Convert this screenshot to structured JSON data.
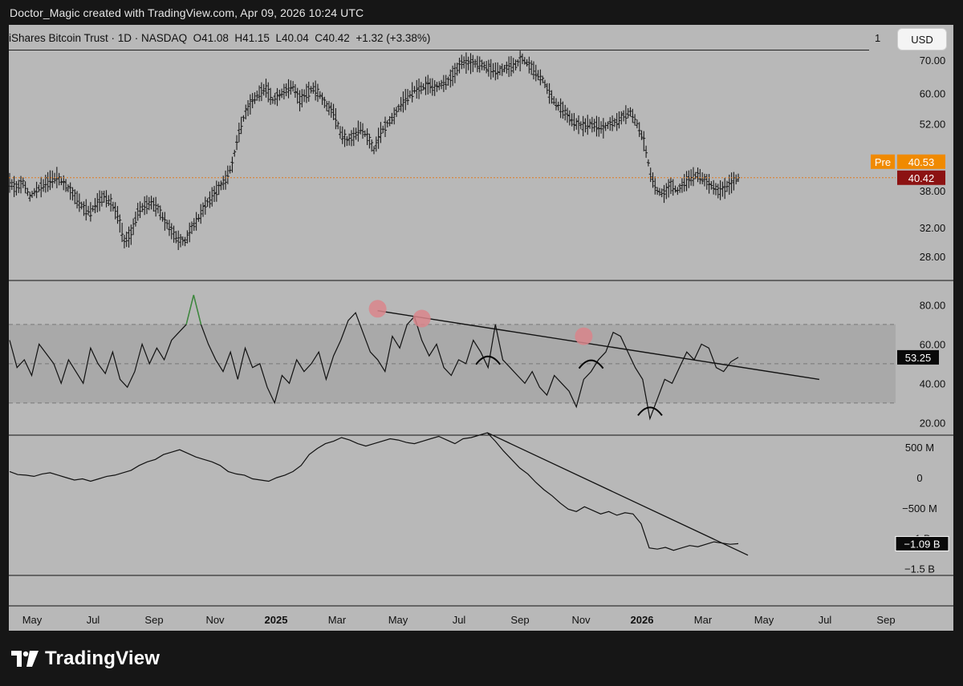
{
  "caption": "Doctor_Magic created with TradingView.com, Apr 09, 2026 10:24 UTC",
  "symbol": {
    "title": "iShares Bitcoin Trust · 1D · NASDAQ",
    "open": "O41.08",
    "high": "H41.15",
    "low": "L40.04",
    "close": "C40.42",
    "change": "+1.32 (+3.38%)"
  },
  "scale_mode": "1",
  "currency": "USD",
  "brand": "TradingView",
  "colors": {
    "background": "#b8b8b8",
    "price_line": "#e07b20",
    "pre_label": "#f08a00",
    "last_label": "#8c1212",
    "rsi_band": "#a9a9a9",
    "dark_label": "#0a0a0a",
    "pivot_marker": "#d9858b"
  },
  "chart_data": [
    {
      "type": "candlestick",
      "series": [
        {
          "name": "iShares Bitcoin Trust",
          "values": [
            39.5,
            38.5,
            39.5,
            37.0,
            38.2,
            39.0,
            40.0,
            40.5,
            39.5,
            38.0,
            36.5,
            35.0,
            34.5,
            36.0,
            37.0,
            36.0,
            34.0,
            30.0,
            31.0,
            34.5,
            35.5,
            36.0,
            35.0,
            33.0,
            31.5,
            30.2,
            30.0,
            32.0,
            33.5,
            35.5,
            37.0,
            38.5,
            40.0,
            43.0,
            50.0,
            55.0,
            58.0,
            60.0,
            61.5,
            58.0,
            59.5,
            61.0,
            62.0,
            58.0,
            60.0,
            61.5,
            59.5,
            56.5,
            55.0,
            50.0,
            48.0,
            49.0,
            51.0,
            49.0,
            46.0,
            50.0,
            52.0,
            54.0,
            57.0,
            59.0,
            61.0,
            61.5,
            62.5,
            61.5,
            62.5,
            63.5,
            66.0,
            69.5,
            69.0,
            69.0,
            68.5,
            67.5,
            66.5,
            67.0,
            68.0,
            68.5,
            70.5,
            68.5,
            66.0,
            64.0,
            60.0,
            57.0,
            55.5,
            53.5,
            52.0,
            51.5,
            52.0,
            51.5,
            51.0,
            52.0,
            52.5,
            54.0,
            55.0,
            52.0,
            48.0,
            41.0,
            38.0,
            37.5,
            39.0,
            38.0,
            39.5,
            40.5,
            41.0,
            40.0,
            39.0,
            38.0,
            38.5,
            39.5,
            40.42
          ]
        }
      ],
      "ylim": [
        25.0,
        73.0
      ],
      "y_scale": "log",
      "y_ticks": [
        "70.00",
        "60.00",
        "52.00",
        "38.00",
        "32.00",
        "28.00"
      ],
      "y_tick_values": [
        70,
        60,
        52,
        38,
        32,
        28
      ],
      "last_close": {
        "label": "40.42",
        "value": 40.42
      },
      "premarket": {
        "tag": "Pre",
        "label": "40.53",
        "value": 40.53
      }
    },
    {
      "type": "line",
      "series": [
        {
          "name": "RSI",
          "values": [
            62,
            48,
            52,
            44,
            60,
            55,
            50,
            40,
            52,
            46,
            40,
            58,
            50,
            45,
            56,
            42,
            38,
            46,
            60,
            50,
            58,
            52,
            62,
            66,
            70,
            85,
            70,
            60,
            52,
            46,
            56,
            42,
            58,
            48,
            50,
            38,
            30,
            44,
            40,
            52,
            46,
            50,
            56,
            42,
            54,
            62,
            72,
            76,
            66,
            56,
            52,
            46,
            64,
            58,
            70,
            74,
            62,
            54,
            60,
            48,
            44,
            52,
            50,
            62,
            56,
            48,
            70,
            52,
            48,
            44,
            40,
            46,
            38,
            34,
            44,
            40,
            36,
            28,
            42,
            46,
            52,
            56,
            66,
            64,
            56,
            48,
            42,
            22,
            32,
            42,
            40,
            48,
            56,
            52,
            60,
            58,
            48,
            46,
            51,
            53.25
          ]
        }
      ],
      "ylim": [
        14,
        92
      ],
      "y_ticks": [
        "80.00",
        "60.00",
        "40.00",
        "20.00"
      ],
      "y_tick_values": [
        80,
        60,
        40,
        20
      ],
      "band": [
        30,
        70
      ],
      "midline": 50,
      "last": {
        "label": "53.25",
        "value": 53.25
      },
      "trendline_points": [
        [
          50,
          77
        ],
        [
          110,
          42
        ]
      ],
      "pivot_marker_points": [
        [
          50,
          78
        ],
        [
          56,
          73
        ],
        [
          78,
          64
        ]
      ],
      "annotation_arcs_near": [
        65,
        79,
        87
      ]
    },
    {
      "type": "line",
      "series": [
        {
          "name": "Volume flow",
          "values": [
            100,
            50,
            40,
            20,
            60,
            80,
            40,
            0,
            -40,
            -20,
            -60,
            -20,
            20,
            40,
            80,
            120,
            200,
            260,
            300,
            380,
            420,
            460,
            400,
            340,
            300,
            260,
            200,
            100,
            60,
            40,
            -20,
            -40,
            -60,
            0,
            40,
            100,
            200,
            380,
            480,
            560,
            600,
            660,
            620,
            560,
            520,
            560,
            600,
            640,
            620,
            580,
            560,
            600,
            640,
            680,
            620,
            560,
            640,
            660,
            700,
            740,
            600,
            440,
            300,
            160,
            60,
            -80,
            -200,
            -300,
            -420,
            -520,
            -560,
            -480,
            -540,
            -600,
            -560,
            -620,
            -580,
            -600,
            -760,
            -1160,
            -1180,
            -1150,
            -1200,
            -1160,
            -1120,
            -1140,
            -1100,
            -1060,
            -1080,
            -1100,
            -1090
          ]
        }
      ],
      "ylim": [
        -1600,
        700
      ],
      "y_ticks": [
        "500 M",
        "0",
        "−500 M",
        "−1 B",
        "−1.5 B"
      ],
      "y_tick_values": [
        500000000,
        0,
        -500000000,
        -1000000000,
        -1500000000
      ],
      "last": {
        "label": "−1.09 B",
        "value": -1090000000
      },
      "trendline": "descending line from Oct 2025 peak to Apr 2026"
    }
  ],
  "time_axis": {
    "labels": [
      "May",
      "Jul",
      "Sep",
      "Nov",
      "2025",
      "Mar",
      "May",
      "Jul",
      "Sep",
      "Nov",
      "2026",
      "Mar",
      "May",
      "Jul",
      "Sep"
    ],
    "bold": [
      "2025",
      "2026"
    ]
  }
}
